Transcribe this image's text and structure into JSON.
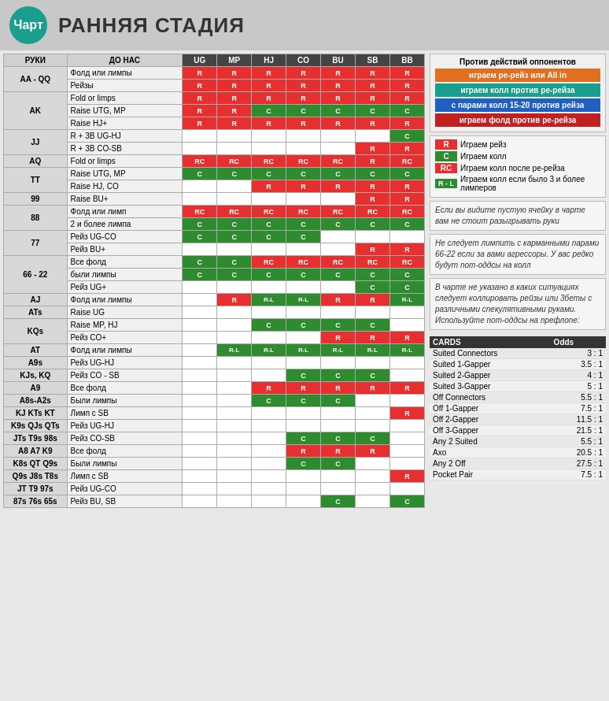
{
  "header": {
    "logo": "Чарт",
    "title": "РАННЯЯ СТАДИЯ"
  },
  "table": {
    "headers": {
      "ruki": "РУКИ",
      "doNas": "ДО НАС",
      "positions": [
        "UG",
        "MP",
        "HJ",
        "CO",
        "BU",
        "SB",
        "BB"
      ]
    },
    "rows": [
      {
        "group": "AA - QQ",
        "subrows": [
          {
            "action": "Фолд или лимпы",
            "cells": [
              "R",
              "R",
              "R",
              "R",
              "R",
              "R",
              "R"
            ]
          },
          {
            "action": "Рейзы",
            "cells": [
              "R",
              "R",
              "R",
              "R",
              "R",
              "R",
              "R"
            ]
          }
        ]
      },
      {
        "group": "AK",
        "subrows": [
          {
            "action": "Fold or limps",
            "cells": [
              "R",
              "R",
              "R",
              "R",
              "R",
              "R",
              "R"
            ]
          },
          {
            "action": "Raise UTG, MP",
            "cells": [
              "R",
              "R",
              "C",
              "C",
              "C",
              "C",
              "C"
            ]
          },
          {
            "action": "Raise HJ+",
            "cells": [
              "R",
              "R",
              "R",
              "R",
              "R",
              "R",
              "R"
            ]
          }
        ]
      },
      {
        "group": "JJ",
        "subrows": [
          {
            "action": "R + 3B UG-HJ",
            "cells": [
              "",
              "",
              "",
              "",
              "",
              "",
              "C"
            ]
          },
          {
            "action": "R + 3B CO-SB",
            "cells": [
              "",
              "",
              "",
              "",
              "",
              "R",
              "R"
            ]
          }
        ]
      },
      {
        "group": "AQ",
        "subrows": [
          {
            "action": "Fold or limps",
            "cells": [
              "RC",
              "RC",
              "RC",
              "RC",
              "RC",
              "R",
              "RC"
            ]
          }
        ]
      },
      {
        "group": "TT",
        "subrows": [
          {
            "action": "Raise UTG, MP",
            "cells": [
              "C",
              "C",
              "C",
              "C",
              "C",
              "C",
              "C"
            ]
          },
          {
            "action": "Raise HJ, CO",
            "cells": [
              "",
              "",
              "R",
              "R",
              "R",
              "R",
              "R"
            ]
          }
        ]
      },
      {
        "group": "99",
        "subrows": [
          {
            "action": "Raise BU+",
            "cells": [
              "",
              "",
              "",
              "",
              "",
              "R",
              "R"
            ]
          }
        ]
      },
      {
        "group": "88",
        "subrows": [
          {
            "action": "Фолд или лимп",
            "cells": [
              "RC",
              "RC",
              "RC",
              "RC",
              "RC",
              "RC",
              "RC"
            ]
          },
          {
            "action": "2 и более лимпа",
            "cells": [
              "C",
              "C",
              "C",
              "C",
              "C",
              "C",
              "C"
            ]
          }
        ]
      },
      {
        "group": "77",
        "subrows": [
          {
            "action": "Рейз UG-CO",
            "cells": [
              "C",
              "C",
              "C",
              "C",
              "",
              "",
              ""
            ]
          },
          {
            "action": "Рейз BU+",
            "cells": [
              "",
              "",
              "",
              "",
              "",
              "R",
              "R"
            ]
          }
        ]
      },
      {
        "group": "66 - 22",
        "subrows": [
          {
            "action": "Все фолд",
            "cells": [
              "C",
              "C",
              "RC",
              "RC",
              "RC",
              "RC",
              "RC"
            ]
          },
          {
            "action": "были лимпы",
            "cells": [
              "C",
              "C",
              "C",
              "C",
              "C",
              "C",
              "C"
            ]
          },
          {
            "action": "Рейз UG+",
            "cells": [
              "",
              "",
              "",
              "",
              "",
              "C",
              "C"
            ]
          }
        ]
      },
      {
        "group": "AJ",
        "subrows": [
          {
            "action": "Фолд или лимпы",
            "cells": [
              "",
              "R",
              "R-L",
              "R-L",
              "R",
              "R",
              "R-L"
            ]
          }
        ]
      },
      {
        "group": "ATs",
        "subrows": [
          {
            "action": "Raise UG",
            "cells": [
              "",
              "",
              "",
              "",
              "",
              "",
              ""
            ]
          }
        ]
      },
      {
        "group": "KQs",
        "subrows": [
          {
            "action": "Raise MP, HJ",
            "cells": [
              "",
              "",
              "C",
              "C",
              "C",
              "C",
              ""
            ]
          },
          {
            "action": "Рейз CO+",
            "cells": [
              "",
              "",
              "",
              "",
              "R",
              "R",
              "R"
            ]
          }
        ]
      },
      {
        "group": "AT",
        "subrows": [
          {
            "action": "Фолд или лимпы",
            "cells": [
              "",
              "R-L",
              "R-L",
              "R-L",
              "R-L",
              "R-L",
              "R-L"
            ]
          }
        ]
      },
      {
        "group": "A9s",
        "subrows": [
          {
            "action": "Рейз UG-HJ",
            "cells": [
              "",
              "",
              "",
              "",
              "",
              "",
              ""
            ]
          }
        ]
      },
      {
        "group": "KJs, KQ",
        "subrows": [
          {
            "action": "Рейз CO - SB",
            "cells": [
              "",
              "",
              "",
              "C",
              "C",
              "C",
              ""
            ]
          }
        ]
      },
      {
        "group": "A9",
        "subrows": [
          {
            "action": "Все фолд",
            "cells": [
              "",
              "",
              "R",
              "R",
              "R",
              "R",
              "R"
            ]
          }
        ]
      },
      {
        "group": "A8s-A2s",
        "subrows": [
          {
            "action": "Были лимпы",
            "cells": [
              "",
              "",
              "C",
              "C",
              "C",
              "",
              ""
            ]
          }
        ]
      },
      {
        "group": "KJ  KTs  KT",
        "subrows": [
          {
            "action": "Лимп с SB",
            "cells": [
              "",
              "",
              "",
              "",
              "",
              "",
              "R"
            ]
          }
        ]
      },
      {
        "group": "K9s  QJs  QTs",
        "subrows": [
          {
            "action": "Рейз UG-HJ",
            "cells": [
              "",
              "",
              "",
              "",
              "",
              "",
              ""
            ]
          }
        ]
      },
      {
        "group": "JTs  T9s  98s",
        "subrows": [
          {
            "action": "Рейз CO-SB",
            "cells": [
              "",
              "",
              "",
              "C",
              "C",
              "C",
              ""
            ]
          }
        ]
      },
      {
        "group": "A8  A7  K9",
        "subrows": [
          {
            "action": "Все фолд",
            "cells": [
              "",
              "",
              "",
              "R",
              "R",
              "R",
              ""
            ]
          }
        ]
      },
      {
        "group": "K8s  QT  Q9s",
        "subrows": [
          {
            "action": "Были лимпы",
            "cells": [
              "",
              "",
              "",
              "C",
              "C",
              "",
              ""
            ]
          }
        ]
      },
      {
        "group": "Q9s  J8s  T8s",
        "subrows": [
          {
            "action": "Лимп с SB",
            "cells": [
              "",
              "",
              "",
              "",
              "",
              "",
              "R"
            ]
          }
        ]
      },
      {
        "group": "JT  T9  97s",
        "subrows": [
          {
            "action": "Рейз UG-CO",
            "cells": [
              "",
              "",
              "",
              "",
              "",
              "",
              ""
            ]
          }
        ]
      },
      {
        "group": "87s  76s  65s",
        "subrows": [
          {
            "action": "Рейз BU, SB",
            "cells": [
              "",
              "",
              "",
              "",
              "C",
              "",
              "C"
            ]
          }
        ]
      }
    ]
  },
  "legend": {
    "title": "Против действий оппонентов",
    "bars": [
      {
        "text": "играем ре-рейз или All in",
        "color": "orange"
      },
      {
        "text": "играем колл против ре-рейза",
        "color": "teal"
      },
      {
        "text": "с парами колл 15-20 против рейза",
        "color": "blue"
      },
      {
        "text": "играем фолд против ре-рейза",
        "color": "red"
      }
    ],
    "symbols": [
      {
        "sym": "R",
        "desc": "Играем рейз"
      },
      {
        "sym": "C",
        "desc": "Играем колл"
      },
      {
        "sym": "RC",
        "desc": "Играем колл после ре-рейза"
      },
      {
        "sym": "R-L",
        "desc": "Играем колл если было 3 и более лимперов"
      }
    ],
    "note1": "Если вы видите пустую ячейку в чарте вам не стоит разыгрывать руки",
    "note2": "Не следует лимпить с карманными парами 66-22 если за вами агрессоры. У вас редко будут пот-оддсы на колл",
    "note3": "В чарте не указано в каких ситуациях следует коллировать рейзы или 3беты с различными спекулятивными руками. Используйте пот-оддсы на префлопе:"
  },
  "odds": {
    "headers": [
      "CARDS",
      "Odds"
    ],
    "rows": [
      [
        "Suited Connectors",
        "3 : 1"
      ],
      [
        "Suited 1-Gapper",
        "3.5 : 1"
      ],
      [
        "Suited 2-Gapper",
        "4 : 1"
      ],
      [
        "Suited 3-Gapper",
        "5 : 1"
      ],
      [
        "Off Connectors",
        "5.5 : 1"
      ],
      [
        "Off 1-Gapper",
        "7.5 : 1"
      ],
      [
        "Off 2-Gapper",
        "11.5 : 1"
      ],
      [
        "Off 3-Gapper",
        "21.5 : 1"
      ],
      [
        "Any 2 Suited",
        "5.5 : 1"
      ],
      [
        "Axo",
        "20.5 : 1"
      ],
      [
        "Any 2 Off",
        "27.5 : 1"
      ],
      [
        "Pocket Pair",
        "7.5 : 1"
      ]
    ]
  }
}
